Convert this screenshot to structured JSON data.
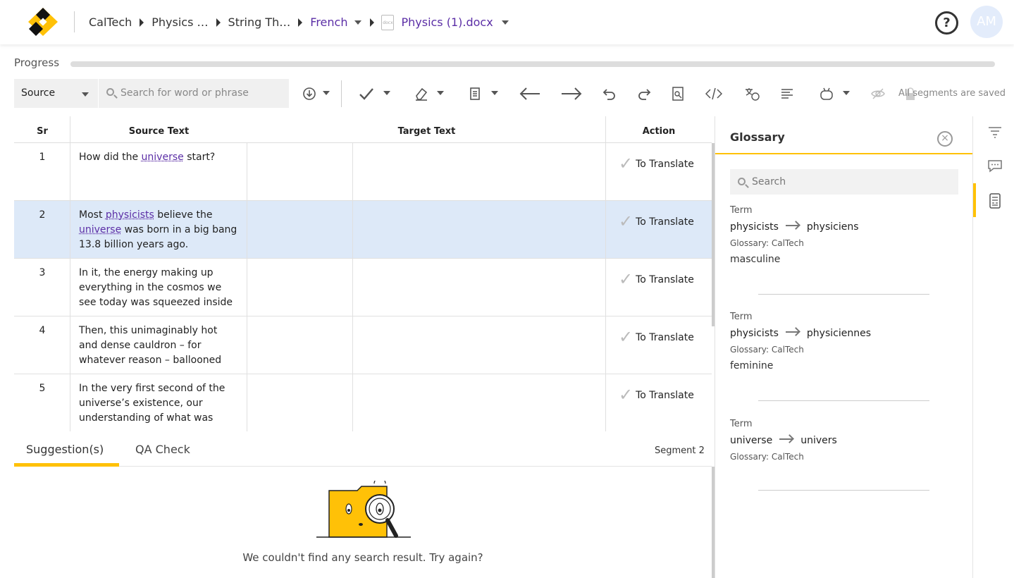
{
  "header": {
    "breadcrumbs": [
      "CalTech",
      "Physics …",
      "String Th…",
      "French"
    ],
    "document": "Physics (1).docx",
    "avatar_initials": "AM",
    "help_icon": "question-icon"
  },
  "progress": {
    "label": "Progress",
    "value": 0
  },
  "toolbar": {
    "source_select": "Source",
    "search_placeholder": "Search for word or phrase",
    "status": "All segments are saved",
    "icons": [
      "download-icon",
      "confirm-check-icon",
      "eraser-icon",
      "copy-source-icon",
      "prev-segment-icon",
      "next-segment-icon",
      "undo-icon",
      "redo-icon",
      "preview-icon",
      "tags-code-icon",
      "machine-translate-icon",
      "align-icon",
      "ai-assistant-icon",
      "visibility-off-icon",
      "lock-icon"
    ]
  },
  "grid": {
    "headers": {
      "sr": "Sr",
      "source": "Source Text",
      "target": "Target Text",
      "action": "Action"
    },
    "rows": [
      {
        "sr": "1",
        "parts": [
          [
            "How did the ",
            false
          ],
          [
            "universe",
            true
          ],
          [
            " start?",
            false
          ]
        ],
        "status": "To Translate",
        "selected": false
      },
      {
        "sr": "2",
        "parts": [
          [
            "Most ",
            false
          ],
          [
            "physicists",
            true
          ],
          [
            " believe the ",
            false
          ],
          [
            "universe",
            true
          ],
          [
            " was born in a big bang 13.8 billion years ago.",
            false
          ]
        ],
        "status": "To Translate",
        "selected": true
      },
      {
        "sr": "3",
        "parts": [
          [
            "In it, the energy making up everything in the cosmos we see today was squeezed inside",
            false
          ]
        ],
        "status": "To Translate",
        "selected": false
      },
      {
        "sr": "4",
        "parts": [
          [
            "Then, this unimaginably hot and dense cauldron – for whatever reason – ballooned",
            false
          ]
        ],
        "status": "To Translate",
        "selected": false
      },
      {
        "sr": "5",
        "parts": [
          [
            "In the very first second of the universe’s existence, our understanding of what was",
            false
          ]
        ],
        "status": "To Translate",
        "selected": false
      }
    ]
  },
  "bottom": {
    "tabs": [
      "Suggestion(s)",
      "QA Check"
    ],
    "segment": "Segment 2",
    "empty_message": "We couldn't find any search result. Try again?"
  },
  "glossary": {
    "title": "Glossary",
    "search_placeholder": "Search",
    "entries": [
      {
        "label": "Term",
        "source": "physicists",
        "target": "physiciens",
        "glossary": "Glossary: CalTech",
        "note": "masculine"
      },
      {
        "label": "Term",
        "source": "physicists",
        "target": "physiciennes",
        "glossary": "Glossary: CalTech",
        "note": "feminine"
      },
      {
        "label": "Term",
        "source": "universe",
        "target": "univers",
        "glossary": "Glossary: CalTech",
        "note": ""
      }
    ]
  },
  "rail": {
    "icons": [
      "filter-icon",
      "comments-icon",
      "glossary-book-icon"
    ]
  },
  "colors": {
    "accent": "#ffc107",
    "link": "#5b2ea6",
    "selected_row": "#dde9f8"
  }
}
